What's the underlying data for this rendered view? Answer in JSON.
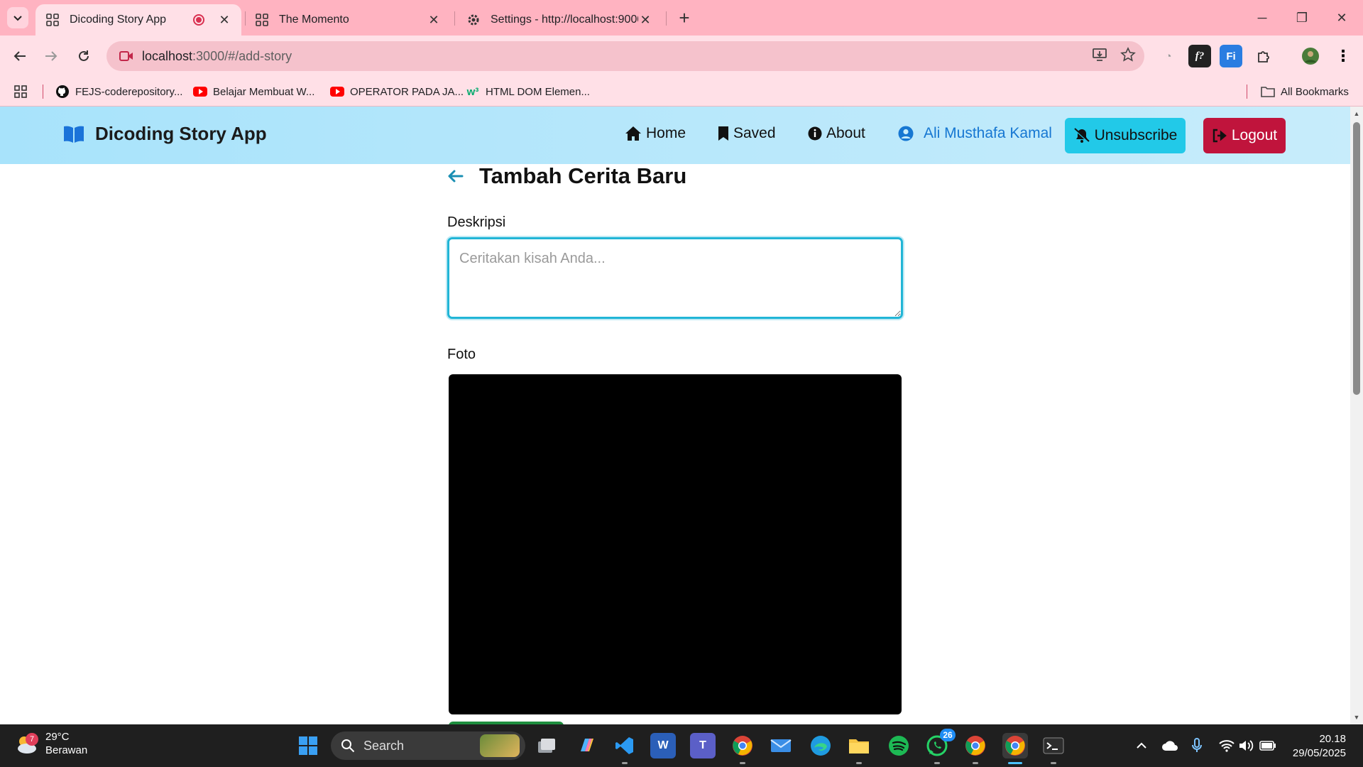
{
  "browser": {
    "tabs": [
      {
        "title": "Dicoding Story App",
        "active": true
      },
      {
        "title": "The Momento",
        "active": false
      },
      {
        "title": "Settings - http://localhost:9000",
        "active": false
      }
    ],
    "url_host": "localhost",
    "url_path": ":3000/#/add-story",
    "bookmarks": [
      {
        "label": "FEJS-coderepository...",
        "icon": "github-icon"
      },
      {
        "label": "Belajar Membuat W...",
        "icon": "youtube-icon"
      },
      {
        "label": "OPERATOR PADA JA...",
        "icon": "youtube-icon"
      },
      {
        "label": "HTML DOM Elemen...",
        "icon": "w3schools-icon"
      }
    ],
    "all_bookmarks": "All Bookmarks"
  },
  "app": {
    "brand": "Dicoding Story App",
    "nav": {
      "home": "Home",
      "saved": "Saved",
      "about": "About",
      "user": "Ali Musthafa Kamal",
      "unsubscribe": "Unsubscribe",
      "logout": "Logout"
    },
    "page_title": "Tambah Cerita Baru",
    "form": {
      "description_label": "Deskripsi",
      "description_placeholder": "Ceritakan kisah Anda...",
      "description_value": "",
      "photo_label": "Foto"
    },
    "colors": {
      "header": "#a8e3fb",
      "accent": "#21b5d6",
      "unsubscribe": "#22c9e8",
      "logout": "#c0143c",
      "user": "#1677d2"
    }
  },
  "taskbar": {
    "weather_temp": "29°C",
    "weather_desc": "Berawan",
    "weather_badge": "7",
    "search_label": "Search",
    "whatsapp_badge": "26",
    "time": "20.18",
    "date": "29/05/2025"
  }
}
